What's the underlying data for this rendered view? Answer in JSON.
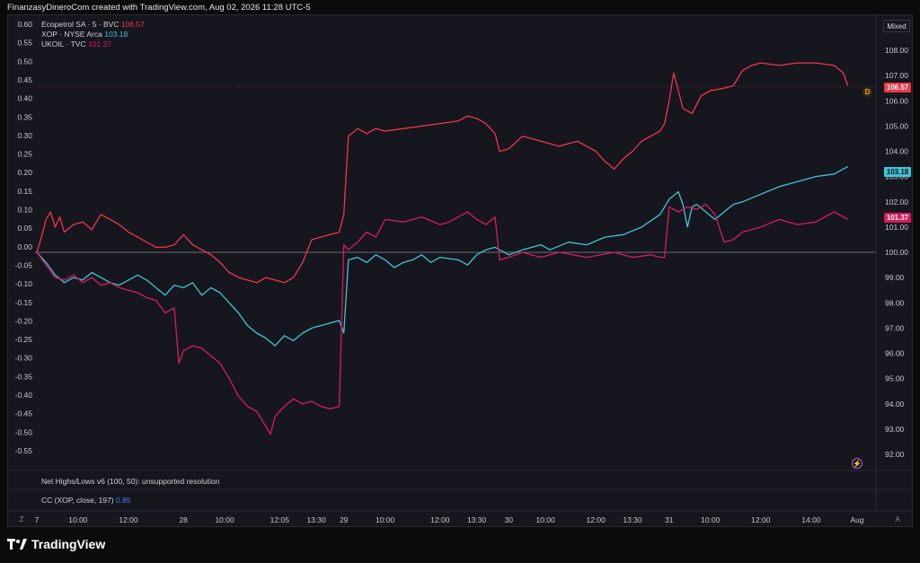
{
  "header": {
    "text": "FinanzasyDineroCom created with TradingView.com, Aug 02, 2026 11:28 UTC-5"
  },
  "legend": {
    "s1_name": "Ecopetrol SA · 5 · BVC",
    "s1_value": "106.57",
    "s2_name": "XOP · NYSE Arca",
    "s2_value": "103.18",
    "s3_name": "UKOIL · TVC",
    "s3_value": "101.37"
  },
  "indicators": {
    "net_highs": "Net Highs/Lows v6 (100, 50): unsupported resolution",
    "cc_label": "CC (XOP, close, 197)",
    "cc_value": "0.85"
  },
  "mode_button": "Mixed",
  "marker_d": "D",
  "corner_left": "Z",
  "corner_right": "A",
  "colors": {
    "ecopetrol": "#f23645",
    "xop": "#3fc6d8",
    "ukoil": "#d81b60",
    "background": "#16161f"
  },
  "footer": {
    "brand": "TradingView"
  },
  "chart_data": {
    "type": "line",
    "left_axis": {
      "ticks": [
        "0.60",
        "0.55",
        "0.50",
        "0.45",
        "0.40",
        "0.35",
        "0.30",
        "0.25",
        "0.20",
        "0.15",
        "0.10",
        "0.05",
        "0.00",
        "-0.05",
        "-0.10",
        "-0.15",
        "-0.20",
        "-0.25",
        "-0.30",
        "-0.35",
        "-0.40",
        "-0.45",
        "-0.50",
        "-0.55"
      ]
    },
    "right_axis": {
      "ticks": [
        "108.00",
        "107.00",
        "106.00",
        "105.00",
        "104.00",
        "103.00",
        "102.00",
        "101.00",
        "100.00",
        "99.00",
        "98.00",
        "97.00",
        "96.00",
        "95.00",
        "94.00",
        "93.00",
        "92.00"
      ],
      "ylim": [
        92,
        108
      ]
    },
    "x_ticks": [
      {
        "label": "7",
        "t": 0
      },
      {
        "label": "10:00",
        "t": 9
      },
      {
        "label": "12:00",
        "t": 20
      },
      {
        "label": "28",
        "t": 32
      },
      {
        "label": "10:00",
        "t": 41
      },
      {
        "label": "12:05",
        "t": 53
      },
      {
        "label": "13:30",
        "t": 61
      },
      {
        "label": "29",
        "t": 67
      },
      {
        "label": "10:00",
        "t": 76
      },
      {
        "label": "12:00",
        "t": 88
      },
      {
        "label": "13:30",
        "t": 96
      },
      {
        "label": "30",
        "t": 103
      },
      {
        "label": "10:00",
        "t": 111
      },
      {
        "label": "12:00",
        "t": 122
      },
      {
        "label": "13:30",
        "t": 130
      },
      {
        "label": "31",
        "t": 138
      },
      {
        "label": "10:00",
        "t": 147
      },
      {
        "label": "12:00",
        "t": 158
      },
      {
        "label": "14:00",
        "t": 169
      },
      {
        "label": "Aug",
        "t": 179
      }
    ],
    "series": [
      {
        "name": "Ecopetrol SA · 5 · BVC",
        "last": 106.57,
        "points": [
          [
            0,
            100.0
          ],
          [
            1,
            100.6
          ],
          [
            2,
            101.3
          ],
          [
            3,
            101.6
          ],
          [
            4,
            101.0
          ],
          [
            5,
            101.4
          ],
          [
            6,
            100.8
          ],
          [
            8,
            101.1
          ],
          [
            10,
            101.2
          ],
          [
            12,
            100.9
          ],
          [
            14,
            101.5
          ],
          [
            16,
            101.3
          ],
          [
            18,
            101.1
          ],
          [
            20,
            100.8
          ],
          [
            22,
            100.6
          ],
          [
            24,
            100.4
          ],
          [
            26,
            100.2
          ],
          [
            28,
            100.2
          ],
          [
            30,
            100.3
          ],
          [
            32,
            100.7
          ],
          [
            34,
            100.3
          ],
          [
            36,
            100.1
          ],
          [
            38,
            99.9
          ],
          [
            40,
            99.6
          ],
          [
            42,
            99.2
          ],
          [
            44,
            99.0
          ],
          [
            46,
            98.9
          ],
          [
            48,
            98.8
          ],
          [
            50,
            99.0
          ],
          [
            52,
            98.9
          ],
          [
            54,
            98.8
          ],
          [
            56,
            99.0
          ],
          [
            58,
            99.6
          ],
          [
            60,
            100.5
          ],
          [
            62,
            100.6
          ],
          [
            64,
            100.7
          ],
          [
            66,
            100.8
          ],
          [
            67,
            101.5
          ],
          [
            68,
            104.6
          ],
          [
            70,
            104.9
          ],
          [
            72,
            104.7
          ],
          [
            74,
            104.9
          ],
          [
            76,
            104.8
          ],
          [
            80,
            104.9
          ],
          [
            84,
            105.0
          ],
          [
            88,
            105.1
          ],
          [
            92,
            105.2
          ],
          [
            94,
            105.4
          ],
          [
            96,
            105.3
          ],
          [
            98,
            105.1
          ],
          [
            100,
            104.7
          ],
          [
            101,
            104.0
          ],
          [
            103,
            104.1
          ],
          [
            106,
            104.6
          ],
          [
            110,
            104.4
          ],
          [
            114,
            104.2
          ],
          [
            118,
            104.4
          ],
          [
            120,
            104.2
          ],
          [
            122,
            104.0
          ],
          [
            124,
            103.6
          ],
          [
            126,
            103.3
          ],
          [
            128,
            103.7
          ],
          [
            130,
            104.0
          ],
          [
            132,
            104.4
          ],
          [
            134,
            104.6
          ],
          [
            136,
            104.8
          ],
          [
            137,
            105.1
          ],
          [
            138,
            106.0
          ],
          [
            139,
            107.1
          ],
          [
            140,
            106.4
          ],
          [
            141,
            105.7
          ],
          [
            143,
            105.5
          ],
          [
            145,
            106.2
          ],
          [
            147,
            106.4
          ],
          [
            150,
            106.5
          ],
          [
            152,
            106.6
          ],
          [
            154,
            107.2
          ],
          [
            156,
            107.4
          ],
          [
            158,
            107.5
          ],
          [
            162,
            107.4
          ],
          [
            166,
            107.5
          ],
          [
            170,
            107.5
          ],
          [
            174,
            107.4
          ],
          [
            176,
            107.1
          ],
          [
            177,
            106.6
          ]
        ]
      },
      {
        "name": "XOP · NYSE Arca",
        "last": 103.18,
        "points": [
          [
            0,
            100.0
          ],
          [
            2,
            99.6
          ],
          [
            4,
            99.1
          ],
          [
            6,
            98.8
          ],
          [
            8,
            99.0
          ],
          [
            10,
            98.9
          ],
          [
            12,
            99.2
          ],
          [
            14,
            99.0
          ],
          [
            16,
            98.8
          ],
          [
            18,
            98.7
          ],
          [
            20,
            98.9
          ],
          [
            22,
            99.1
          ],
          [
            24,
            98.9
          ],
          [
            26,
            98.6
          ],
          [
            28,
            98.3
          ],
          [
            30,
            98.7
          ],
          [
            32,
            98.6
          ],
          [
            34,
            98.8
          ],
          [
            36,
            98.3
          ],
          [
            38,
            98.6
          ],
          [
            40,
            98.4
          ],
          [
            42,
            98.0
          ],
          [
            44,
            97.6
          ],
          [
            46,
            97.1
          ],
          [
            48,
            96.8
          ],
          [
            50,
            96.6
          ],
          [
            52,
            96.3
          ],
          [
            54,
            96.7
          ],
          [
            56,
            96.5
          ],
          [
            58,
            96.8
          ],
          [
            60,
            97.0
          ],
          [
            62,
            97.1
          ],
          [
            64,
            97.2
          ],
          [
            66,
            97.3
          ],
          [
            67,
            96.8
          ],
          [
            68,
            99.7
          ],
          [
            70,
            99.8
          ],
          [
            72,
            99.6
          ],
          [
            74,
            99.9
          ],
          [
            76,
            99.7
          ],
          [
            78,
            99.4
          ],
          [
            80,
            99.6
          ],
          [
            82,
            99.7
          ],
          [
            84,
            99.9
          ],
          [
            86,
            99.6
          ],
          [
            88,
            99.8
          ],
          [
            92,
            99.7
          ],
          [
            94,
            99.5
          ],
          [
            96,
            99.9
          ],
          [
            98,
            100.1
          ],
          [
            100,
            100.2
          ],
          [
            103,
            99.9
          ],
          [
            106,
            100.1
          ],
          [
            110,
            100.3
          ],
          [
            112,
            100.1
          ],
          [
            116,
            100.4
          ],
          [
            120,
            100.3
          ],
          [
            124,
            100.6
          ],
          [
            128,
            100.7
          ],
          [
            132,
            101.0
          ],
          [
            136,
            101.5
          ],
          [
            138,
            102.1
          ],
          [
            140,
            102.4
          ],
          [
            141,
            101.9
          ],
          [
            142,
            101.0
          ],
          [
            143,
            101.8
          ],
          [
            144,
            101.9
          ],
          [
            146,
            101.6
          ],
          [
            148,
            101.3
          ],
          [
            150,
            101.6
          ],
          [
            152,
            101.9
          ],
          [
            154,
            102.0
          ],
          [
            158,
            102.3
          ],
          [
            162,
            102.6
          ],
          [
            166,
            102.8
          ],
          [
            170,
            103.0
          ],
          [
            174,
            103.1
          ],
          [
            177,
            103.4
          ]
        ]
      },
      {
        "name": "UKOIL · TVC",
        "last": 101.37,
        "points": [
          [
            0,
            100.0
          ],
          [
            2,
            99.5
          ],
          [
            4,
            99.0
          ],
          [
            6,
            98.9
          ],
          [
            8,
            99.1
          ],
          [
            10,
            98.8
          ],
          [
            12,
            99.0
          ],
          [
            14,
            98.7
          ],
          [
            16,
            98.8
          ],
          [
            18,
            98.6
          ],
          [
            20,
            98.5
          ],
          [
            22,
            98.4
          ],
          [
            24,
            98.2
          ],
          [
            26,
            98.1
          ],
          [
            28,
            97.6
          ],
          [
            30,
            97.8
          ],
          [
            31,
            95.6
          ],
          [
            32,
            96.1
          ],
          [
            34,
            96.3
          ],
          [
            36,
            96.2
          ],
          [
            38,
            95.9
          ],
          [
            40,
            95.6
          ],
          [
            42,
            95.0
          ],
          [
            44,
            94.3
          ],
          [
            46,
            93.9
          ],
          [
            48,
            93.7
          ],
          [
            50,
            93.1
          ],
          [
            51,
            92.8
          ],
          [
            52,
            93.5
          ],
          [
            54,
            93.9
          ],
          [
            56,
            94.2
          ],
          [
            58,
            94.0
          ],
          [
            60,
            94.1
          ],
          [
            62,
            93.9
          ],
          [
            64,
            93.8
          ],
          [
            66,
            93.9
          ],
          [
            67,
            100.3
          ],
          [
            68,
            100.1
          ],
          [
            70,
            100.4
          ],
          [
            72,
            100.8
          ],
          [
            74,
            100.6
          ],
          [
            76,
            101.3
          ],
          [
            80,
            101.2
          ],
          [
            84,
            101.4
          ],
          [
            88,
            101.1
          ],
          [
            90,
            101.2
          ],
          [
            92,
            101.4
          ],
          [
            94,
            101.6
          ],
          [
            96,
            101.3
          ],
          [
            98,
            101.1
          ],
          [
            100,
            101.4
          ],
          [
            101,
            99.7
          ],
          [
            103,
            99.8
          ],
          [
            106,
            100.0
          ],
          [
            110,
            99.8
          ],
          [
            114,
            100.0
          ],
          [
            120,
            99.8
          ],
          [
            126,
            100.0
          ],
          [
            130,
            99.8
          ],
          [
            134,
            99.9
          ],
          [
            136,
            99.8
          ],
          [
            137,
            99.8
          ],
          [
            138,
            101.8
          ],
          [
            140,
            101.6
          ],
          [
            142,
            101.8
          ],
          [
            144,
            101.7
          ],
          [
            146,
            101.9
          ],
          [
            148,
            101.5
          ],
          [
            150,
            100.4
          ],
          [
            152,
            100.5
          ],
          [
            154,
            100.8
          ],
          [
            158,
            101.0
          ],
          [
            162,
            101.3
          ],
          [
            166,
            101.1
          ],
          [
            170,
            101.2
          ],
          [
            174,
            101.6
          ],
          [
            176,
            101.4
          ],
          [
            177,
            101.3
          ]
        ]
      }
    ]
  }
}
